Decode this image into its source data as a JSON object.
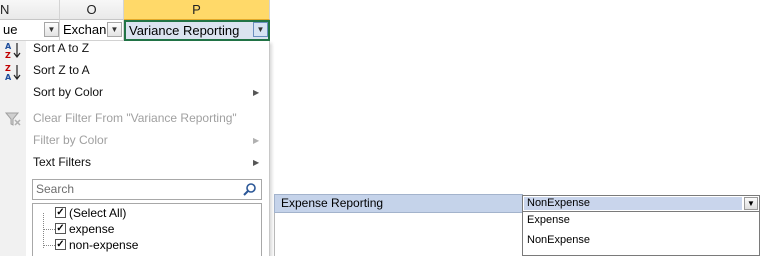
{
  "columns": [
    {
      "letter": "N"
    },
    {
      "letter": "O"
    },
    {
      "letter": "P"
    }
  ],
  "header_cells": [
    "ue",
    "Exchan",
    "Variance Reporting"
  ],
  "menu": {
    "items": [
      {
        "label": "Sort A to Z",
        "enabled": true,
        "icon": "sort-az-icon"
      },
      {
        "label": "Sort Z to A",
        "enabled": true,
        "icon": "sort-za-icon"
      },
      {
        "label": "Sort by Color",
        "enabled": true,
        "submenu": true
      },
      {
        "label": "Clear Filter From \"Variance Reporting\"",
        "enabled": false,
        "icon": "clear-filter-icon"
      },
      {
        "label": "Filter by Color",
        "enabled": false,
        "submenu": true
      },
      {
        "label": "Text Filters",
        "enabled": true,
        "submenu": true
      }
    ],
    "search_placeholder": "Search",
    "values": [
      {
        "label": "(Select All)",
        "checked": true
      },
      {
        "label": "expense",
        "checked": true
      },
      {
        "label": "non-expense",
        "checked": true
      }
    ]
  },
  "form": {
    "row_label": "Expense Reporting",
    "selected": "NonExpense",
    "options": [
      "Expense",
      "NonExpense"
    ]
  },
  "icon_glyphs": {
    "check": "✓",
    "dropdown": "▼",
    "submenu": "▶"
  }
}
